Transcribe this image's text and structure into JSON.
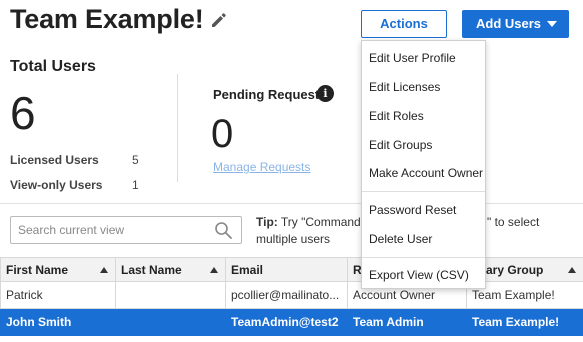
{
  "header": {
    "title": "Team Example!",
    "actions_label": "Actions",
    "add_users_label": "Add Users"
  },
  "stats": {
    "total_users_label": "Total Users",
    "total_users_value": "6",
    "licensed_users_label": "Licensed Users",
    "licensed_users_value": "5",
    "view_only_users_label": "View-only Users",
    "view_only_users_value": "1",
    "pending_requests_label": "Pending Requests",
    "pending_requests_value": "0",
    "manage_requests_link": "Manage Requests"
  },
  "search": {
    "placeholder": "Search current view"
  },
  "tip": {
    "prefix": "Tip:",
    "text_line1": "Try \"Command",
    "text_right": "\" to select",
    "text_line2": "multiple users"
  },
  "table": {
    "columns": [
      "First Name",
      "Last Name",
      "Email",
      "Ro",
      "imary Group"
    ],
    "rows": [
      [
        "Patrick",
        "",
        "pcollier@mailinato...",
        "Account Owner",
        "Team Example!"
      ],
      [
        "John Smith",
        "",
        "TeamAdmin@test2",
        "Team Admin",
        "Team Example!"
      ]
    ]
  },
  "actions_menu": {
    "group1": [
      "Edit User Profile",
      "Edit Licenses",
      "Edit Roles",
      "Edit Groups",
      "Make Account Owner"
    ],
    "group2": [
      "Password Reset",
      "Delete User"
    ],
    "group3": [
      "Export View (CSV)"
    ]
  },
  "colors": {
    "primary": "#1a6fd4",
    "link_muted": "#8ab4e6",
    "selected_row": "#1a6fd4"
  },
  "icons": [
    "pencil-edit-icon",
    "info-icon",
    "search-icon",
    "caret-down-icon",
    "sort-up-icon"
  ]
}
